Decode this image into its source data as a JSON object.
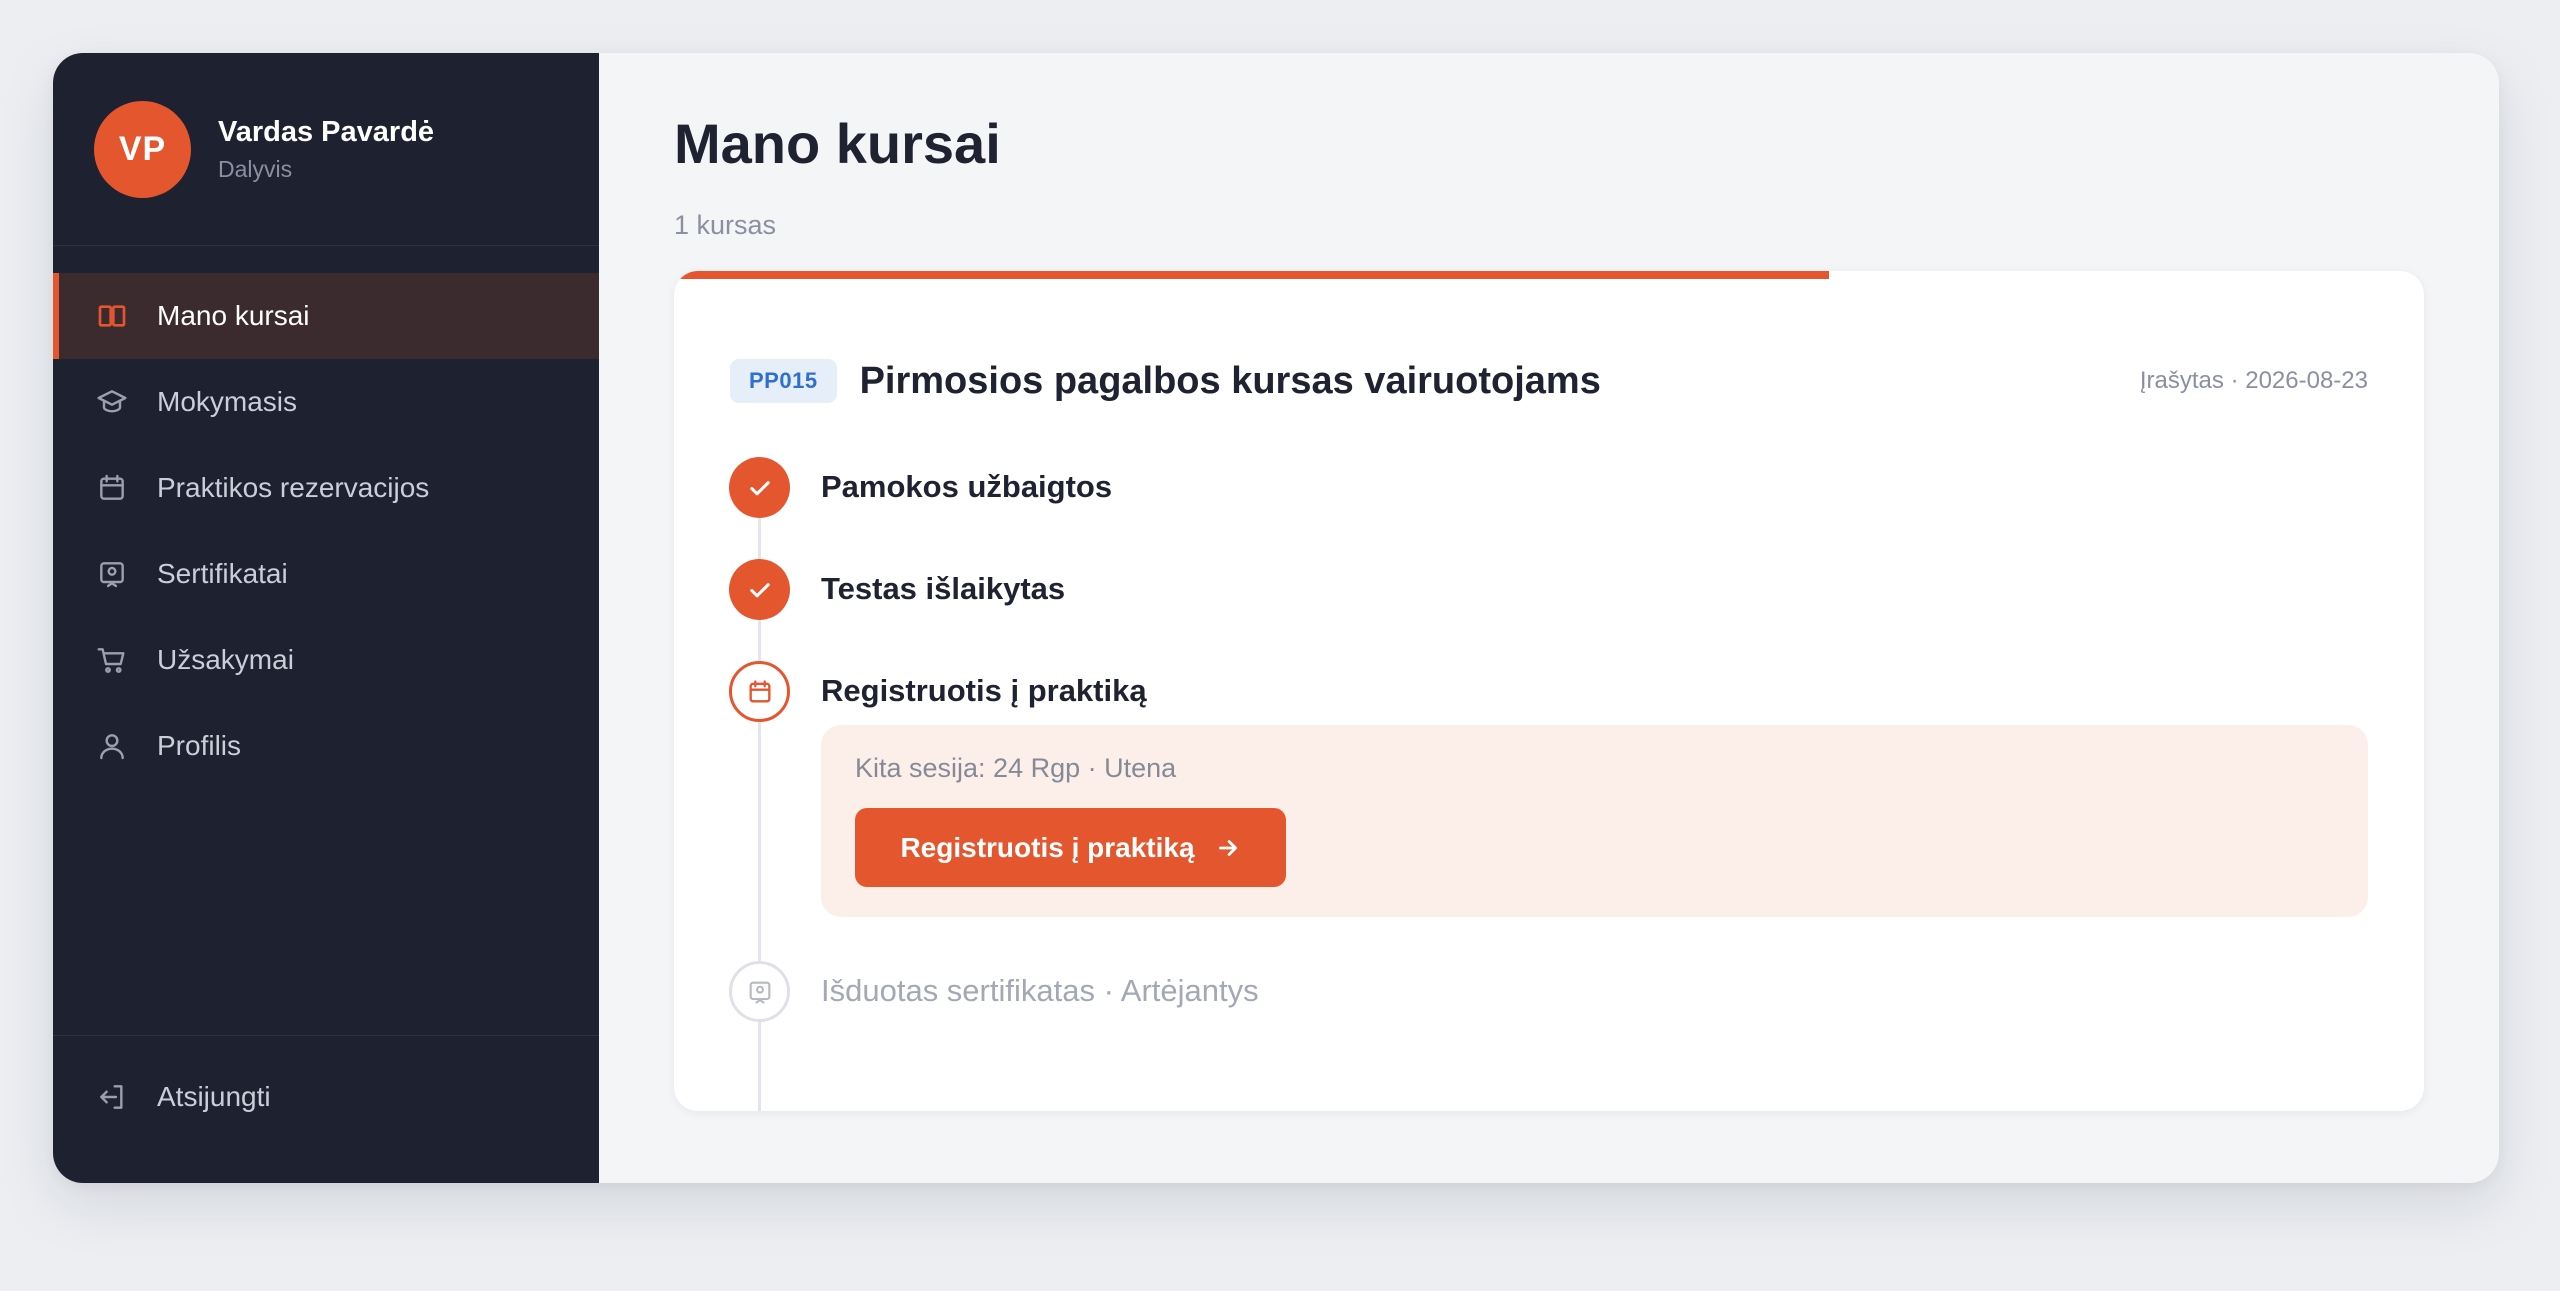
{
  "user": {
    "initials": "VP",
    "name": "Vardas Pavardė",
    "role": "Dalyvis"
  },
  "sidebar": {
    "items": [
      {
        "label": "Mano kursai",
        "icon": "book-open-icon",
        "active": true
      },
      {
        "label": "Mokymasis",
        "icon": "graduation-cap-icon"
      },
      {
        "label": "Praktikos rezervacijos",
        "icon": "calendar-icon"
      },
      {
        "label": "Sertifikatai",
        "icon": "certificate-icon"
      },
      {
        "label": "Užsakymai",
        "icon": "cart-icon"
      },
      {
        "label": "Profilis",
        "icon": "user-icon"
      }
    ],
    "logout_label": "Atsijungti"
  },
  "main": {
    "title": "Mano kursai",
    "count": "1 kursas"
  },
  "course": {
    "code": "PP015",
    "title": "Pirmosios pagalbos kursas vairuotojams",
    "enrolled": "Įrašytas · 2026-08-23",
    "progress_percent": 66,
    "steps": [
      {
        "label": "Pamokos užbaigtos",
        "status": "done",
        "icon": "check-icon"
      },
      {
        "label": "Testas išlaikytas",
        "status": "done",
        "icon": "check-icon"
      },
      {
        "label": "Registruotis į praktiką",
        "status": "current",
        "icon": "calendar-icon"
      },
      {
        "label": "Išduotas sertifikatas · Artėjantys",
        "status": "pending",
        "icon": "certificate-icon"
      }
    ],
    "next_session": "Kita sesija: 24 Rgp · Utena",
    "cta_label": "Registruotis į praktiką"
  },
  "colors": {
    "accent": "#e4562d",
    "sidebar_bg": "#1e2130",
    "badge_bg": "#e6eef9",
    "badge_text": "#2f6fd0"
  }
}
